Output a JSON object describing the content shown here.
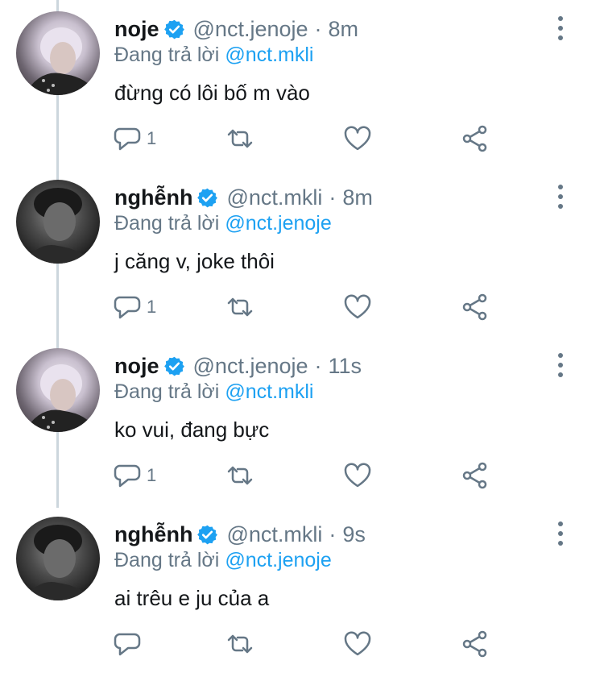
{
  "colors": {
    "link": "#1da1f2",
    "muted": "#657786",
    "text": "#14171a",
    "verified": "#1da1f2",
    "thread_line": "#ccd6dd"
  },
  "icons": {
    "reply": "speech-bubble-icon",
    "retweet": "retweet-arrows-icon",
    "like": "heart-outline-icon",
    "share": "share-nodes-icon",
    "more": "vertical-dots-icon",
    "verified": "verified-badge-icon"
  },
  "tweets": [
    {
      "name": "noje",
      "handle": "@nct.jenoje",
      "separator": "·",
      "time": "8m",
      "reply_prefix": "Đang trả lời",
      "reply_to": "@nct.mkli",
      "text": "đừng có lôi bố m vào",
      "reply_count": "1"
    },
    {
      "name": "nghễnh",
      "handle": "@nct.mkli",
      "separator": "·",
      "time": "8m",
      "reply_prefix": "Đang trả lời",
      "reply_to": "@nct.jenoje",
      "text": "j căng v, joke thôi",
      "reply_count": "1"
    },
    {
      "name": "noje",
      "handle": "@nct.jenoje",
      "separator": "·",
      "time": "11s",
      "reply_prefix": "Đang trả lời",
      "reply_to": "@nct.mkli",
      "text": "ko vui, đang bực",
      "reply_count": "1"
    },
    {
      "name": "nghễnh",
      "handle": "@nct.mkli",
      "separator": "·",
      "time": "9s",
      "reply_prefix": "Đang trả lời",
      "reply_to": "@nct.jenoje",
      "text": "ai trêu e ju của a",
      "reply_count": ""
    }
  ]
}
